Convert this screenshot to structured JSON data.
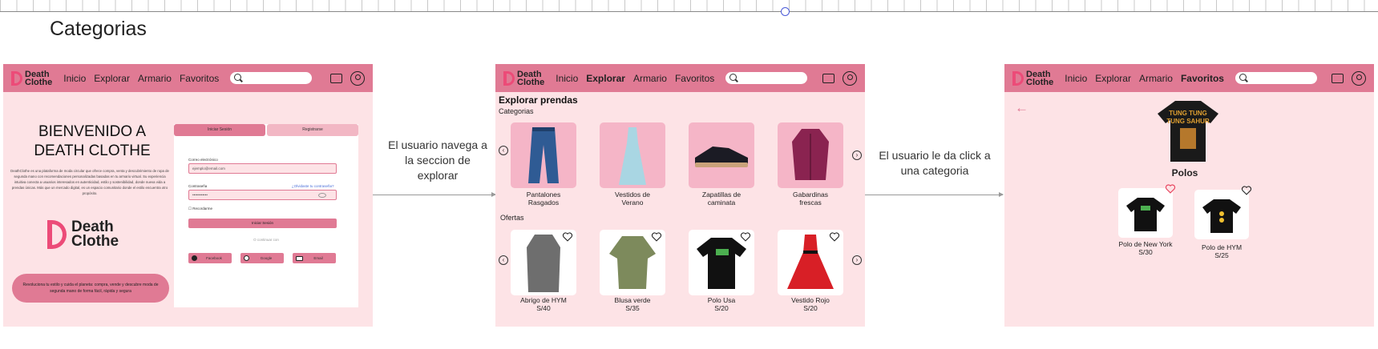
{
  "page_title": "Categorias",
  "colors": {
    "nav": "#e07a94",
    "frame_bg": "#fde3e6",
    "card_bg": "#f5b5c7",
    "accent": "#ec4b78"
  },
  "nav": {
    "logo_line1": "Death",
    "logo_line2": "Clothe",
    "items": [
      "Inicio",
      "Explorar",
      "Armario",
      "Favoritos"
    ]
  },
  "arrows": [
    {
      "text": "El usuario navega a la seccion de explorar"
    },
    {
      "text": "El usuario le da click a una categoria"
    }
  ],
  "home": {
    "title": "BIENVENIDO A DEATH CLOTHE",
    "description": "DeathClothe es una plataforma de moda circular que ofrece compra, venta y descubrimiento de ropa de segunda mano con recomendaciones personalizadas basadas en tu armario virtual. Su experiencia intuitiva conecta a usuarios interesados en autenticidad, estilo y sostenibilidad, donde nueva vida a prendas únicas. Más que un mercado digital, es un espacio comunitario donde el estilo encuentra otro propósito.",
    "logo_line1": "Death",
    "logo_line2": "Clothe",
    "cta": "Revoluciona tu estilo y cuida el planeta: compra, vende y descubre moda de segunda mano de forma fácil, rápida y segura",
    "auth": {
      "tab_login": "Iniciar Sesión",
      "tab_register": "Registrarse",
      "email_label": "Correo electrónico",
      "email_value": "ejemplo@email.com",
      "password_label": "Contraseña",
      "forgot": "¿Olvidaste tu contraseña?",
      "password_value": "••••••••••••",
      "remember": "Recordarme",
      "login_button": "Iniciar Sesión",
      "divider": "O continuar con",
      "social": [
        "Facebook",
        "Google",
        "Email"
      ]
    }
  },
  "explore": {
    "title": "Explorar prendas",
    "categories_label": "Categorias",
    "categories": [
      {
        "name": "Pantalones Rasgados",
        "line1": "Pantalones",
        "line2": "Rasgados",
        "icon": "jeans-icon"
      },
      {
        "name": "Vestidos de Verano",
        "line1": "Vestidos de",
        "line2": "Verano",
        "icon": "dress-icon"
      },
      {
        "name": "Zapatillas de caminata",
        "line1": "Zapatillas de",
        "line2": "caminata",
        "icon": "sneaker-icon"
      },
      {
        "name": "Gabardinas frescas",
        "line1": "Gabardinas",
        "line2": "frescas",
        "icon": "coat-icon"
      }
    ],
    "offers_label": "Ofertas",
    "offers": [
      {
        "name": "Abrigo de HYM",
        "price": "S/40",
        "icon": "coat-icon"
      },
      {
        "name": "Blusa verde",
        "price": "S/35",
        "icon": "blouse-icon"
      },
      {
        "name": "Polo Usa",
        "price": "S/20",
        "icon": "tshirt-icon"
      },
      {
        "name": "Vestido Rojo",
        "price": "S/20",
        "icon": "dress-icon"
      }
    ]
  },
  "category": {
    "hero_text_1": "TUNG TUNG",
    "hero_text_2": "TUNG SAHUR",
    "title": "Polos",
    "products": [
      {
        "name": "Polo de New York",
        "price": "S/30",
        "favorited": true
      },
      {
        "name": "Polo de HYM",
        "price": "S/25",
        "favorited": false
      }
    ]
  }
}
